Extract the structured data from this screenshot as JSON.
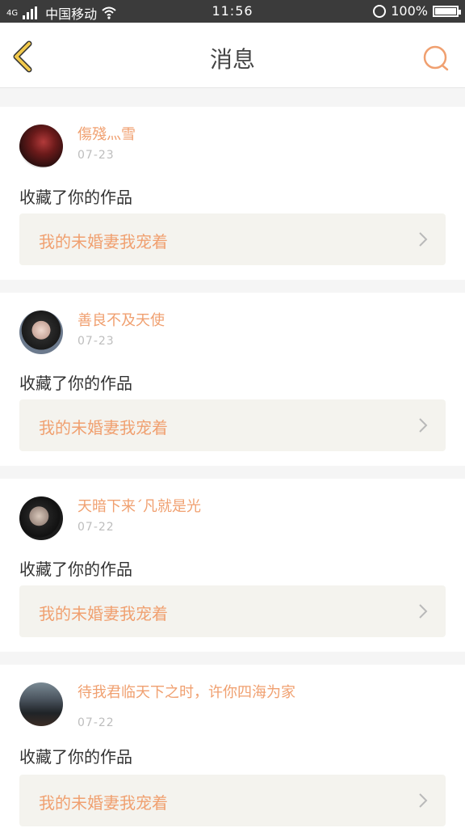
{
  "status_bar": {
    "carrier": "中国移动",
    "network": "4G",
    "time": "11:56",
    "battery": "100%"
  },
  "header": {
    "title": "消息"
  },
  "messages": [
    {
      "username": "傷殘灬雪",
      "date": "07-23",
      "action": "收藏了你的作品",
      "work_title": "我的未婚妻我宠着"
    },
    {
      "username": "善良不及天使",
      "date": "07-23",
      "action": "收藏了你的作品",
      "work_title": "我的未婚妻我宠着"
    },
    {
      "username": "天暗下来´凡就是光",
      "date": "07-22",
      "action": "收藏了你的作品",
      "work_title": "我的未婚妻我宠着"
    },
    {
      "username": "待我君临天下之时，许你四海为家",
      "date": "07-22",
      "action": "收藏了你的作品",
      "work_title": "我的未婚妻我宠着"
    }
  ],
  "colors": {
    "accent": "#f0a070",
    "back_arrow": "#f2c94c",
    "card_link_bg": "#f4f3ee",
    "status_bar_bg": "#3b3b3b"
  },
  "icons": [
    "signal-icon",
    "wifi-icon",
    "alarm-icon",
    "battery-icon",
    "back-arrow-icon",
    "search-icon",
    "chevron-right-icon"
  ]
}
